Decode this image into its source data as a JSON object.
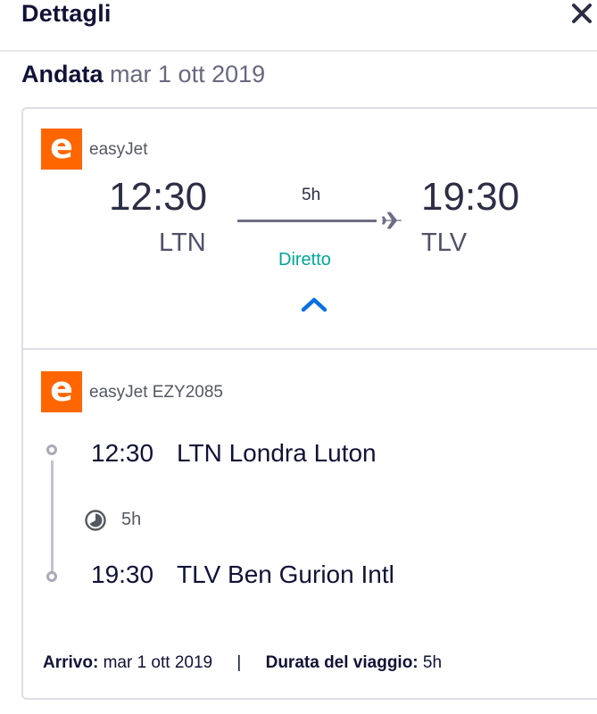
{
  "header": {
    "title": "Dettagli",
    "close_icon": "close-icon"
  },
  "leg": {
    "direction": "Andata",
    "date": "mar 1 ott 2019"
  },
  "summary": {
    "airline": "easyJet",
    "logo_letter": "e",
    "logo_color": "#ff6600",
    "depart_time": "12:30",
    "depart_code": "LTN",
    "arrive_time": "19:30",
    "arrive_code": "TLV",
    "duration": "5h",
    "stops": "Diretto",
    "stops_color": "#00a698",
    "expand_icon": "chevron-up-icon",
    "plane_icon": "plane-icon"
  },
  "segment": {
    "airline": "easyJet",
    "flight_number": "EZY2085",
    "logo_letter": "e",
    "depart_time": "12:30",
    "depart_place": "LTN Londra Luton",
    "duration": "5h",
    "arrive_time": "19:30",
    "arrive_place": "TLV Ben Gurion Intl"
  },
  "footer": {
    "arrival_label": "Arrivo:",
    "arrival_value": "mar 1 ott 2019",
    "separator": "|",
    "duration_label": "Durata del viaggio:",
    "duration_value": "5h"
  }
}
